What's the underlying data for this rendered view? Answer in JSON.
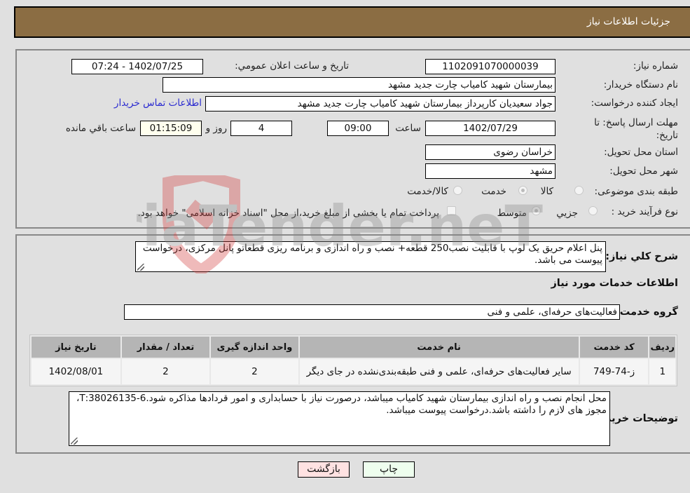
{
  "header": {
    "title": "جزئیات اطلاعات نیاز"
  },
  "fields": {
    "need_number_label": "شماره نیاز:",
    "need_number": "1102091070000039",
    "announce_label": "تاریخ و ساعت اعلان عمومي:",
    "announce_value": "1402/07/25 - 07:24",
    "buyer_org_label": "نام دستگاه خریدار:",
    "buyer_org": "بیمارستان شهید کامیاب چارت جدید مشهد",
    "creator_label": "ایجاد کننده درخواست:",
    "creator": "جواد سعیدیان کارپرداز بیمارستان شهید کامیاب چارت جدید مشهد",
    "contact_link": "اطلاعات تماس خریدار",
    "deadline_label": "مهلت ارسال پاسخ: تا تاریخ:",
    "deadline_date": "1402/07/29",
    "time_label": "ساعت",
    "deadline_time": "09:00",
    "days": "4",
    "days_label": "روز و",
    "remaining": "01:15:09",
    "remaining_label": "ساعت باقي مانده",
    "province_label": "استان محل تحویل:",
    "province": "خراسان رضوی",
    "city_label": "شهر محل تحویل:",
    "city": "مشهد",
    "category_label": "طبقه بندی موضوعی:",
    "category_options": [
      {
        "label": "کالا",
        "selected": false
      },
      {
        "label": "خدمت",
        "selected": true
      },
      {
        "label": "کالا/خدمت",
        "selected": false
      }
    ],
    "process_label": "نوع فرآیند خرید :",
    "process_options": [
      {
        "label": "جزيي",
        "selected": false
      },
      {
        "label": "متوسط",
        "selected": true
      }
    ],
    "payment_note": "پرداخت تمام یا بخشی از مبلغ خرید،از محل \"اسناد خزانه اسلامی\" خواهد بود.",
    "payment_checked": false
  },
  "description": {
    "label": "شرح کلي نیاز:",
    "text": "پنل اعلام حریق یک لوپ با قابلیت نصب250 قطعه+ نصب و راه اندازی و برنامه ریزی قطعاتو پانل مرکزی، درخواست پیوست می باشد."
  },
  "services": {
    "section_title": "اطلاعات خدمات مورد نیاز",
    "group_label": "گروه خدمت:",
    "group_value": "فعالیت‌های حرفه‌ای، علمی و فنی",
    "columns": [
      "ردیف",
      "کد خدمت",
      "نام خدمت",
      "واحد اندازه گیری",
      "تعداد / مقدار",
      "تاریخ نیاز"
    ],
    "rows": [
      [
        "1",
        "ز-74-749",
        "سایر فعالیت‌های حرفه‌ای، علمی و فنی طبقه‌بندی‌نشده در جای دیگر",
        "2",
        "2",
        "1402/08/01"
      ]
    ]
  },
  "buyer_notes": {
    "label": "توضیحات خریدار:",
    "text": "محل انجام نصب و راه اندازی بیمارستان شهید کامیاب میباشد، درصورت نیاز با حسابداری و امور قردادها مذاکره شود.6-38026135:T، مجوز های لازم را داشته باشد.درخواست پیوست میباشد."
  },
  "buttons": {
    "print": "چاپ",
    "back": "بازگشت"
  },
  "watermark": {
    "text": "AriaTender.neT"
  }
}
